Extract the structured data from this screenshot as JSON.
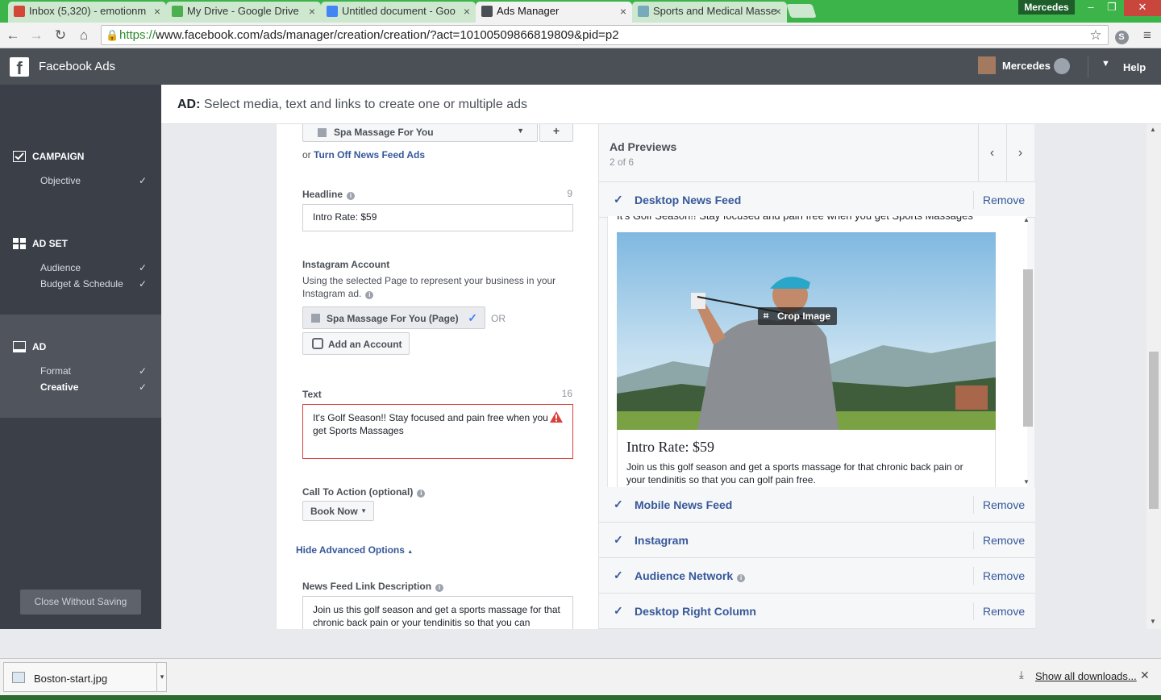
{
  "browser": {
    "tabs": [
      {
        "label": "Inbox (5,320) - emotionm",
        "icon": "gmail-icon",
        "color": "#d44638"
      },
      {
        "label": "My Drive - Google Drive",
        "icon": "drive-icon",
        "color": "#4caf50"
      },
      {
        "label": "Untitled document - Goo",
        "icon": "docs-icon",
        "color": "#4285f4"
      },
      {
        "label": "Ads Manager",
        "icon": "ads-icon",
        "color": "#4b4f56"
      },
      {
        "label": "Sports and Medical Masse",
        "icon": "site-icon",
        "color": "#7ab"
      }
    ],
    "user": "Mercedes",
    "url_scheme": "https://",
    "url_rest": "www.facebook.com/ads/manager/creation/creation/?act=10100509866819809&pid=p2"
  },
  "header": {
    "logo": "f",
    "title": "Facebook Ads",
    "user": "Mercedes",
    "help": "Help"
  },
  "sidebar": {
    "campaign": {
      "title": "CAMPAIGN",
      "items": [
        {
          "label": "Objective",
          "check": "✓"
        }
      ]
    },
    "adset": {
      "title": "AD SET",
      "items": [
        {
          "label": "Audience",
          "check": "✓"
        },
        {
          "label": "Budget & Schedule",
          "check": "✓"
        }
      ]
    },
    "ad": {
      "title": "AD",
      "items": [
        {
          "label": "Format",
          "check": "✓"
        },
        {
          "label": "Creative",
          "check": "✓"
        }
      ]
    },
    "close_button": "Close Without Saving"
  },
  "page": {
    "title_bold": "AD:",
    "title_rest": " Select media, text and links to create one or multiple ads"
  },
  "form": {
    "page_select": "Spa Massage For You",
    "add_btn": "+",
    "or_text": "or ",
    "turn_off_link": "Turn Off News Feed Ads",
    "headline_label": "Headline",
    "headline_count": "9",
    "headline_value": "Intro Rate: $59",
    "ig_label": "Instagram Account",
    "ig_desc": "Using the selected Page to represent your business in your Instagram ad.",
    "ig_page_btn": "Spa Massage For You  (Page)",
    "ig_or": "OR",
    "ig_add": "Add an Account",
    "text_label": "Text",
    "text_count": "16",
    "text_value": "It's Golf Season!! Stay focused and pain free when you get Sports Massages",
    "cta_label": "Call To Action (optional)",
    "cta_value": "Book Now",
    "hide_adv": "Hide Advanced Options",
    "nf_label": "News Feed Link Description",
    "nf_value": " Join us this golf season and get a sports massage for that chronic back pain or your tendinitis so that you can"
  },
  "preview": {
    "title": "Ad Previews",
    "subtitle": "2 of 6",
    "prev": "‹",
    "next": "›",
    "placements": [
      {
        "name": "Desktop News Feed",
        "remove": "Remove"
      },
      {
        "name": "Mobile News Feed",
        "remove": "Remove"
      },
      {
        "name": "Instagram",
        "remove": "Remove"
      },
      {
        "name": "Audience Network",
        "remove": "Remove"
      },
      {
        "name": "Desktop Right Column",
        "remove": "Remove"
      }
    ],
    "ad_text": "It's Golf Season!! Stay focused and pain free when you get Sports Massages",
    "crop": "Crop Image",
    "ad_headline": "Intro Rate: $59",
    "ad_desc": "Join us this golf season and get a sports massage for that chronic back pain or your tendinitis so that you can golf pain free."
  },
  "downloads": {
    "file": "Boston-start.jpg",
    "show_all": "Show all downloads...",
    "close": "✕"
  },
  "colors": {
    "accent": "#365899",
    "error": "#d9413c",
    "sidebar": "#3a3f48",
    "browser_frame": "#3cb44a"
  }
}
